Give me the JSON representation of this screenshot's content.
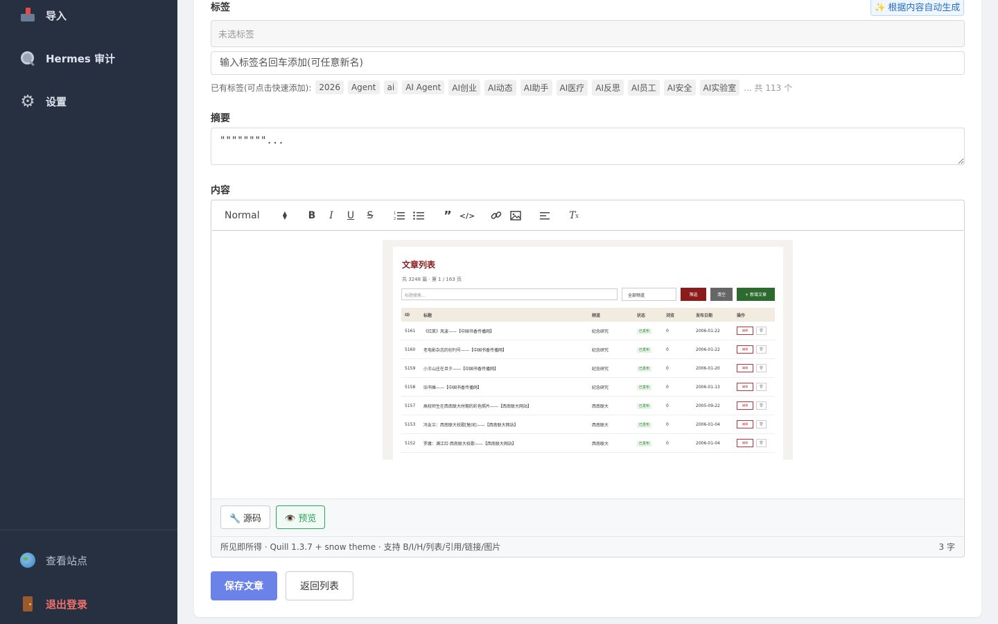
{
  "sidebar": {
    "items": [
      {
        "label": "导入",
        "icon": "inbox-icon"
      },
      {
        "label": "Hermes 审计",
        "icon": "magnifier-icon"
      },
      {
        "label": "设置",
        "icon": "gear-icon"
      }
    ],
    "bottom": [
      {
        "label": "查看站点",
        "icon": "globe-icon"
      },
      {
        "label": "退出登录",
        "icon": "door-icon"
      }
    ]
  },
  "form": {
    "tags_label": "标签",
    "auto_generate": "✨ 根据内容自动生成",
    "tag_select_placeholder": "未选标签",
    "tag_input_placeholder": "输入标签名回车添加(可任意新名)",
    "existing_label": "已有标签(可点击快速添加):",
    "existing_tags": [
      "2026",
      "Agent",
      "ai",
      "AI Agent",
      "AI创业",
      "AI动态",
      "AI助手",
      "AI医疗",
      "AI反思",
      "AI员工",
      "AI安全",
      "AI实验室"
    ],
    "existing_more": "... 共 113 个",
    "summary_label": "摘要",
    "summary_value": "\"\"\"\"\"\"\"\"...",
    "content_label": "内容"
  },
  "editor": {
    "header_select": "Normal",
    "embedded": {
      "title": "文章列表",
      "subtitle": "共 3248 篇 · 第 1 / 163 页",
      "search_placeholder": "标题搜索...",
      "channel_select": "全部频道",
      "filter_btn": "筛选",
      "clear_btn": "清空",
      "new_btn": "+ 新增文章",
      "columns": [
        "ID",
        "标题",
        "频道",
        "状态",
        "浏览",
        "发布日期",
        "操作"
      ],
      "rows": [
        {
          "id": "5161",
          "title": "《红笑》风波——【中国书香传播网】",
          "channel": "纪念研究",
          "status": "已发布",
          "views": "0",
          "date": "2006-01-22"
        },
        {
          "id": "5160",
          "title": "老电影杂志的创刊号——【中国书香传播网】",
          "channel": "纪念研究",
          "status": "已发布",
          "views": "0",
          "date": "2006-01-22"
        },
        {
          "id": "5159",
          "title": "小王山庄在旦夕——【中国书香传播网】",
          "channel": "纪念研究",
          "status": "已发布",
          "views": "0",
          "date": "2006-01-20"
        },
        {
          "id": "5158",
          "title": "旧书摊——【中国书香传播网】",
          "channel": "纪念研究",
          "status": "已发布",
          "views": "0",
          "date": "2006-01-13"
        },
        {
          "id": "5157",
          "title": "高校师生在西南联大时期的彩色照片——【西南联大网站】",
          "channel": "西南联大",
          "status": "已发布",
          "views": "0",
          "date": "2005-09-22"
        },
        {
          "id": "5153",
          "title": "冯友兰：西南联大校歌[勉词]——【西南联大网站】",
          "channel": "西南联大",
          "status": "已发布",
          "views": "0",
          "date": "2006-01-04"
        },
        {
          "id": "5152",
          "title": "罗庸：满江红·西南联大校歌——【西南联大网站】",
          "channel": "西南联大",
          "status": "已发布",
          "views": "0",
          "date": "2006-01-04"
        }
      ],
      "edit_label": "编辑",
      "delete_label": "🗑"
    },
    "source_btn": "🔧 源码",
    "preview_btn": "👁️ 预览",
    "status_text": "所见即所得 · Quill 1.3.7 + snow theme · 支持 B/I/H/列表/引用/链接/图片",
    "char_count": "3 字"
  },
  "actions": {
    "save": "保存文章",
    "back": "返回列表"
  },
  "colors": {
    "sidebar_bg": "#263040",
    "primary": "#6b82e8",
    "success": "#2fa35d",
    "danger": "#f0716b"
  }
}
